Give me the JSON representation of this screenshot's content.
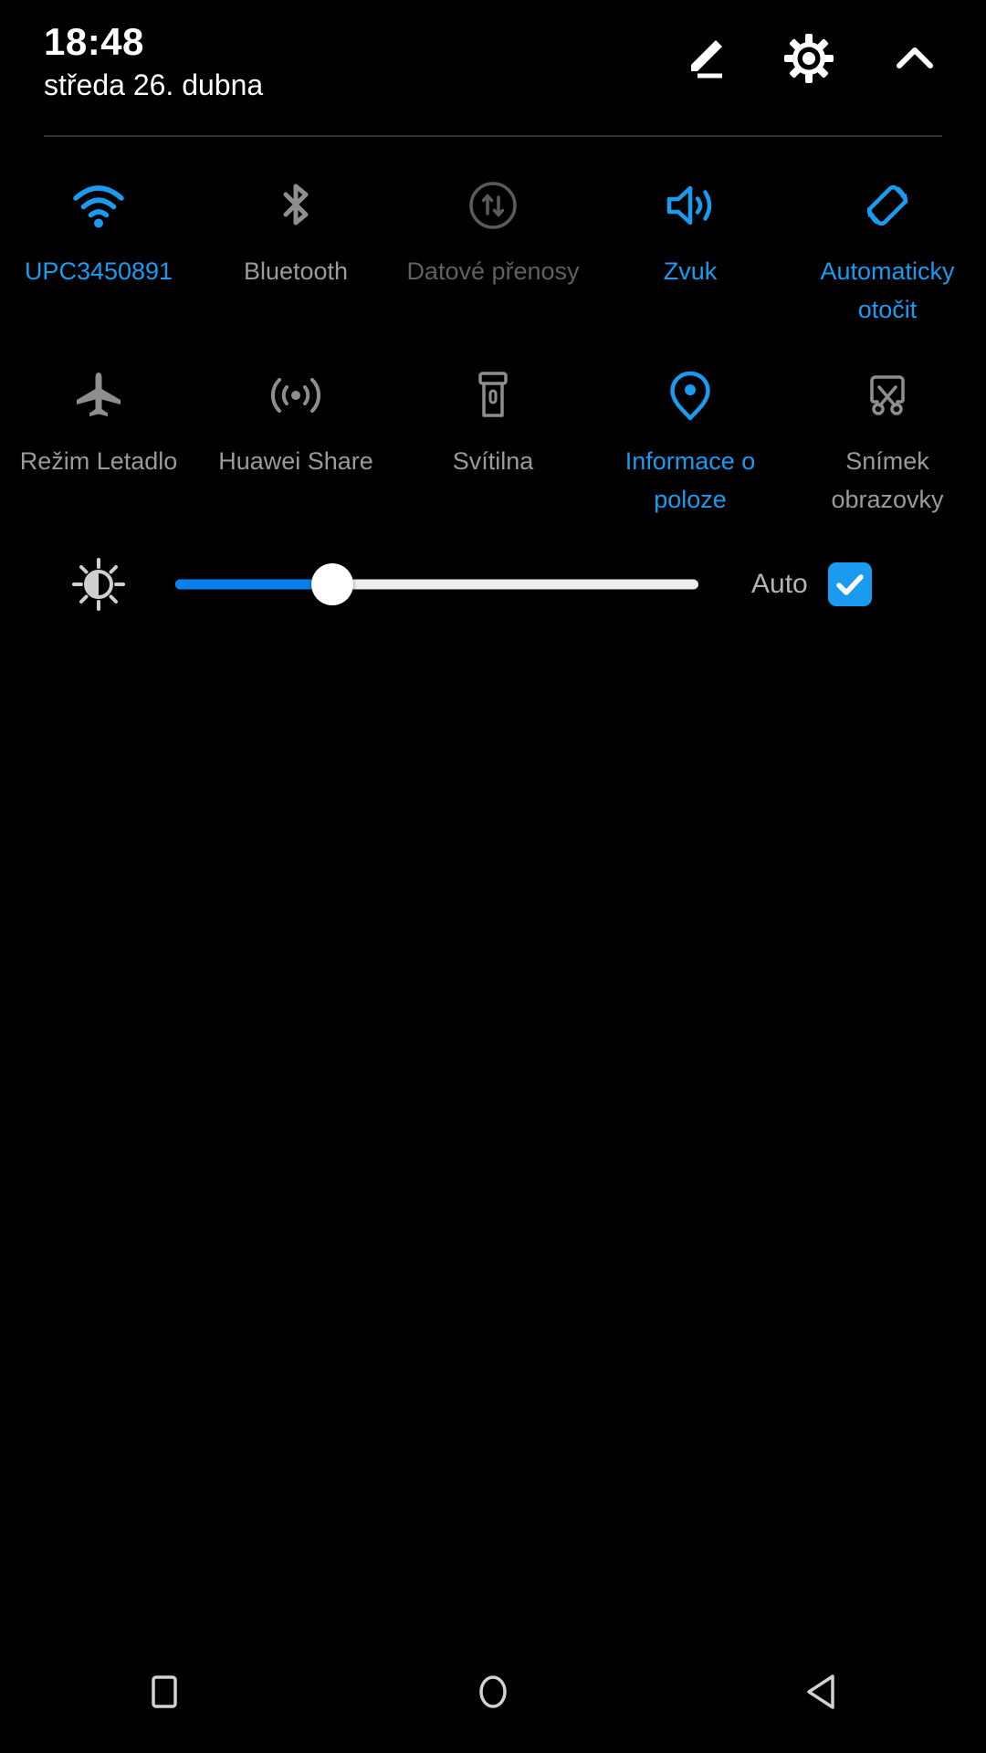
{
  "status_bar": {
    "time": "18:48",
    "date": "středa 26. dubna"
  },
  "header_actions": [
    {
      "name": "edit-icon",
      "label": "Upravit"
    },
    {
      "name": "gear-icon",
      "label": "Nastavení"
    },
    {
      "name": "chevron-up-icon",
      "label": "Sbalit"
    }
  ],
  "colors": {
    "accent_blue": "#1a9bf0",
    "slider_blue": "#0a7ff0",
    "inactive_gray": "#9a9a9a",
    "disabled_gray": "#606060",
    "background": "#000000",
    "divider": "#333333",
    "track": "#eeeeee"
  },
  "tiles": [
    {
      "id": "wifi",
      "icon": "wifi-icon",
      "label": "UPC3450891",
      "state": "on"
    },
    {
      "id": "bluetooth",
      "icon": "bluetooth-icon",
      "label": "Bluetooth",
      "state": "off"
    },
    {
      "id": "mobile-data",
      "icon": "data-transfer-icon",
      "label": "Datové přenosy",
      "state": "disabled"
    },
    {
      "id": "sound",
      "icon": "sound-icon",
      "label": "Zvuk",
      "state": "on"
    },
    {
      "id": "auto-rotate",
      "icon": "auto-rotate-icon",
      "label": "Automaticky otočit",
      "state": "on"
    },
    {
      "id": "airplane",
      "icon": "airplane-icon",
      "label": "Režim Letadlo",
      "state": "off"
    },
    {
      "id": "huawei-share",
      "icon": "broadcast-icon",
      "label": "Huawei Share",
      "state": "off"
    },
    {
      "id": "flashlight",
      "icon": "flashlight-icon",
      "label": "Svítilna",
      "state": "off"
    },
    {
      "id": "location",
      "icon": "location-pin-icon",
      "label": "Informace o poloze",
      "state": "on"
    },
    {
      "id": "screenshot",
      "icon": "screenshot-icon",
      "label": "Snímek obrazovky",
      "state": "off"
    }
  ],
  "brightness": {
    "icon": "brightness-icon",
    "value_percent": 30,
    "auto_label": "Auto",
    "auto_checked": true
  },
  "nav_bar": [
    {
      "name": "recents-button",
      "label": "Přehled"
    },
    {
      "name": "home-button",
      "label": "Domů"
    },
    {
      "name": "back-button",
      "label": "Zpět"
    }
  ]
}
